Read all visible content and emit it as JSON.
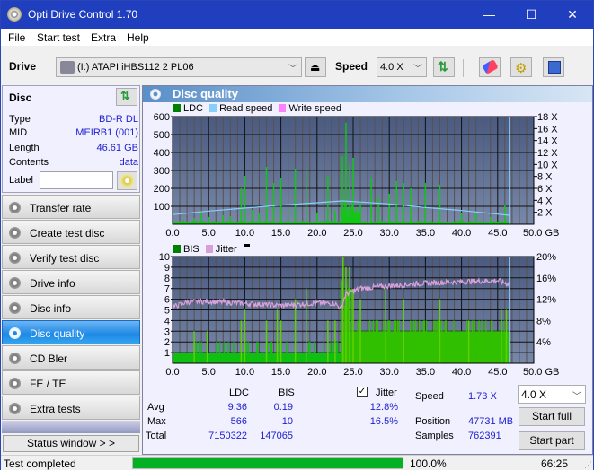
{
  "window": {
    "title": "Opti Drive Control 1.70",
    "minimize": "—",
    "maximize": "☐",
    "close": "✕"
  },
  "menu": [
    "File",
    "Start test",
    "Extra",
    "Help"
  ],
  "toolbar": {
    "drive_label": "Drive",
    "drive_value": "(I:)  ATAPI iHBS112   2 PL06",
    "speed_label": "Speed",
    "speed_value": "4.0 X"
  },
  "disc": {
    "header": "Disc",
    "rows": [
      {
        "key": "Type",
        "value": "BD-R DL"
      },
      {
        "key": "MID",
        "value": "MEIRB1 (001)"
      },
      {
        "key": "Length",
        "value": "46.61 GB"
      },
      {
        "key": "Contents",
        "value": "data"
      }
    ],
    "label_key": "Label",
    "label_value": ""
  },
  "nav": [
    {
      "label": "Transfer rate",
      "active": false
    },
    {
      "label": "Create test disc",
      "active": false
    },
    {
      "label": "Verify test disc",
      "active": false
    },
    {
      "label": "Drive info",
      "active": false
    },
    {
      "label": "Disc info",
      "active": false
    },
    {
      "label": "Disc quality",
      "active": true
    },
    {
      "label": "CD Bler",
      "active": false
    },
    {
      "label": "FE / TE",
      "active": false
    },
    {
      "label": "Extra tests",
      "active": false
    }
  ],
  "status_window_label": "Status window > >",
  "panel": {
    "title": "Disc quality"
  },
  "colors": {
    "ldc": "#008000",
    "bis": "#008000",
    "read_speed": "#87cefa",
    "write_speed": "#ff80ff",
    "jitter": "#d8a0d8",
    "bars": "#10c810",
    "plot_bg_top": "#4a5a80",
    "plot_bg_bottom": "#7888a8",
    "progress": "#06b025"
  },
  "chart_data": [
    {
      "type": "bar",
      "title": "LDC",
      "legend": [
        "LDC",
        "Read speed",
        "Write speed"
      ],
      "legend_position": "top-left",
      "xlabel": "GB",
      "x_ticks": [
        "0.0",
        "5.0",
        "10.0",
        "15.0",
        "20.0",
        "25.0",
        "30.0",
        "35.0",
        "40.0",
        "45.0",
        "50.0 GB"
      ],
      "xlim": [
        0,
        50
      ],
      "y_ticks_left": [
        "100",
        "200",
        "300",
        "400",
        "500",
        "600"
      ],
      "ylim_left": [
        0,
        600
      ],
      "y_ticks_right": [
        "2 X",
        "4 X",
        "6 X",
        "8 X",
        "10 X",
        "12 X",
        "14 X",
        "16 X",
        "18 X"
      ],
      "ylim_right": [
        0,
        18
      ],
      "grid": true,
      "end_marker_gb": 46.61,
      "ldc_peaks": [
        {
          "x": 1.5,
          "y": 25
        },
        {
          "x": 3.0,
          "y": 35
        },
        {
          "x": 4.0,
          "y": 60
        },
        {
          "x": 5.0,
          "y": 40
        },
        {
          "x": 7.0,
          "y": 50
        },
        {
          "x": 8.0,
          "y": 45
        },
        {
          "x": 9.5,
          "y": 200
        },
        {
          "x": 10.0,
          "y": 270
        },
        {
          "x": 11.0,
          "y": 80
        },
        {
          "x": 12.0,
          "y": 60
        },
        {
          "x": 13.0,
          "y": 320
        },
        {
          "x": 14.0,
          "y": 230
        },
        {
          "x": 15.0,
          "y": 260
        },
        {
          "x": 16.0,
          "y": 90
        },
        {
          "x": 17.0,
          "y": 310
        },
        {
          "x": 18.5,
          "y": 300
        },
        {
          "x": 20.0,
          "y": 60
        },
        {
          "x": 21.5,
          "y": 270
        },
        {
          "x": 22.5,
          "y": 80
        },
        {
          "x": 23.5,
          "y": 380
        },
        {
          "x": 24.0,
          "y": 566
        },
        {
          "x": 24.5,
          "y": 330
        },
        {
          "x": 25.0,
          "y": 370
        },
        {
          "x": 26.0,
          "y": 120
        },
        {
          "x": 27.5,
          "y": 260
        },
        {
          "x": 28.5,
          "y": 160
        },
        {
          "x": 30.0,
          "y": 170
        },
        {
          "x": 31.0,
          "y": 240
        },
        {
          "x": 32.0,
          "y": 230
        },
        {
          "x": 33.0,
          "y": 200
        },
        {
          "x": 35.0,
          "y": 230
        },
        {
          "x": 37.0,
          "y": 220
        },
        {
          "x": 40.0,
          "y": 60
        },
        {
          "x": 42.0,
          "y": 70
        },
        {
          "x": 44.0,
          "y": 40
        },
        {
          "x": 46.0,
          "y": 110
        }
      ],
      "read_speed": [
        {
          "x": 0,
          "y": 1.6
        },
        {
          "x": 5,
          "y": 2.2
        },
        {
          "x": 10,
          "y": 2.7
        },
        {
          "x": 15,
          "y": 3.2
        },
        {
          "x": 20,
          "y": 3.6
        },
        {
          "x": 23.5,
          "y": 3.9
        },
        {
          "x": 25,
          "y": 3.8
        },
        {
          "x": 30,
          "y": 3.4
        },
        {
          "x": 35,
          "y": 2.8
        },
        {
          "x": 40,
          "y": 2.3
        },
        {
          "x": 45,
          "y": 1.7
        },
        {
          "x": 46.6,
          "y": 1.5
        }
      ]
    },
    {
      "type": "bar",
      "title": "BIS",
      "legend": [
        "BIS",
        "Jitter"
      ],
      "legend_position": "top-left",
      "xlabel": "GB",
      "x_ticks": [
        "0.0",
        "5.0",
        "10.0",
        "15.0",
        "20.0",
        "25.0",
        "30.0",
        "35.0",
        "40.0",
        "45.0",
        "50.0 GB"
      ],
      "xlim": [
        0,
        50
      ],
      "y_ticks_left": [
        "1",
        "2",
        "3",
        "4",
        "5",
        "6",
        "7",
        "8",
        "9",
        "10"
      ],
      "ylim_left": [
        0,
        10
      ],
      "y_ticks_right": [
        "4%",
        "8%",
        "12%",
        "16%",
        "20%"
      ],
      "ylim_right": [
        0,
        20
      ],
      "grid": true,
      "end_marker_gb": 46.61,
      "bis_segments": [
        {
          "from": 0,
          "to": 23.3,
          "base": 1,
          "peaks": [
            {
              "x": 3.0,
              "y": 3
            },
            {
              "x": 4.8,
              "y": 3
            },
            {
              "x": 9.5,
              "y": 4
            },
            {
              "x": 10.0,
              "y": 5
            },
            {
              "x": 13.0,
              "y": 4
            },
            {
              "x": 14.5,
              "y": 5
            },
            {
              "x": 15.0,
              "y": 4
            },
            {
              "x": 17.0,
              "y": 6
            },
            {
              "x": 18.5,
              "y": 7
            },
            {
              "x": 21.5,
              "y": 4
            },
            {
              "x": 22.5,
              "y": 4
            }
          ]
        },
        {
          "from": 23.3,
          "to": 46.6,
          "base": 3,
          "peaks": [
            {
              "x": 23.6,
              "y": 10
            },
            {
              "x": 24.0,
              "y": 9
            },
            {
              "x": 24.5,
              "y": 9
            },
            {
              "x": 25.0,
              "y": 7
            },
            {
              "x": 26.0,
              "y": 6
            },
            {
              "x": 29.5,
              "y": 7
            },
            {
              "x": 32.0,
              "y": 6
            },
            {
              "x": 37.0,
              "y": 6
            },
            {
              "x": 41.0,
              "y": 4
            },
            {
              "x": 45.5,
              "y": 5
            },
            {
              "x": 46.2,
              "y": 5
            }
          ]
        }
      ],
      "jitter_pct": [
        {
          "x": 0,
          "y": 10.5
        },
        {
          "x": 2,
          "y": 11.5
        },
        {
          "x": 5,
          "y": 11.6
        },
        {
          "x": 10,
          "y": 11.2
        },
        {
          "x": 15,
          "y": 10.8
        },
        {
          "x": 20,
          "y": 11.3
        },
        {
          "x": 22.5,
          "y": 11.2
        },
        {
          "x": 23.3,
          "y": 10.2
        },
        {
          "x": 24,
          "y": 13.0
        },
        {
          "x": 26,
          "y": 14.0
        },
        {
          "x": 30,
          "y": 14.5
        },
        {
          "x": 35,
          "y": 15.0
        },
        {
          "x": 40,
          "y": 15.3
        },
        {
          "x": 45,
          "y": 15.5
        },
        {
          "x": 46.6,
          "y": 14.8
        }
      ]
    }
  ],
  "stats": {
    "col_ldc": "LDC",
    "col_bis": "BIS",
    "jitter_label": "Jitter",
    "jitter_checked": true,
    "rows": [
      {
        "label": "Avg",
        "ldc": "9.36",
        "bis": "0.19",
        "jitter": "12.8%"
      },
      {
        "label": "Max",
        "ldc": "566",
        "bis": "10",
        "jitter": "16.5%"
      },
      {
        "label": "Total",
        "ldc": "7150322",
        "bis": "147065",
        "jitter": ""
      }
    ],
    "speed_label": "Speed",
    "speed_value": "1.73 X",
    "position_label": "Position",
    "position_value": "47731 MB",
    "samples_label": "Samples",
    "samples_value": "762391",
    "speed_select": "4.0 X",
    "start_full": "Start full",
    "start_part": "Start part"
  },
  "statusbar": {
    "message": "Test completed",
    "progress_pct": 100.0,
    "progress_text": "100.0%",
    "elapsed": "66:25"
  }
}
